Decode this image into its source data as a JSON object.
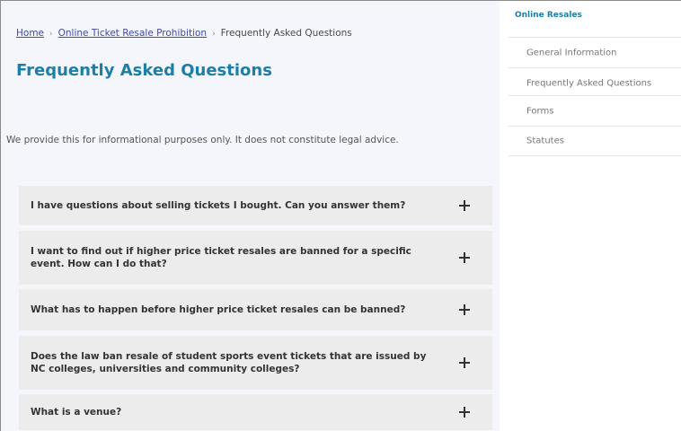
{
  "breadcrumb": {
    "home": "Home",
    "parent": "Online Ticket Resale Prohibition",
    "current": "Frequently Asked Questions",
    "separator": "›"
  },
  "page": {
    "title": "Frequently Asked Questions",
    "disclaimer": "We provide this for informational purposes only. It does not constitute legal advice."
  },
  "faq": [
    {
      "question": "I have questions about selling tickets I bought. Can you answer them?"
    },
    {
      "question": "I want to find out if higher price ticket resales are banned for a specific event. How can I do that?"
    },
    {
      "question": "What has to happen before higher price ticket resales can be banned?"
    },
    {
      "question": "Does the law ban resale of student sports event tickets that are issued by NC colleges, universities and community colleges?"
    },
    {
      "question": "What is a venue?"
    }
  ],
  "sidebar": {
    "title": "Online Resales",
    "items": [
      {
        "label": "General Information"
      },
      {
        "label": "Frequently Asked Questions"
      },
      {
        "label": "Forms"
      },
      {
        "label": "Statutes"
      }
    ]
  },
  "icons": {
    "expand": "plus-icon"
  },
  "colors": {
    "accent": "#1e7fa6",
    "link": "#3d4aa8",
    "content_bg": "#f5f6fb",
    "faq_bg": "#ececed"
  }
}
